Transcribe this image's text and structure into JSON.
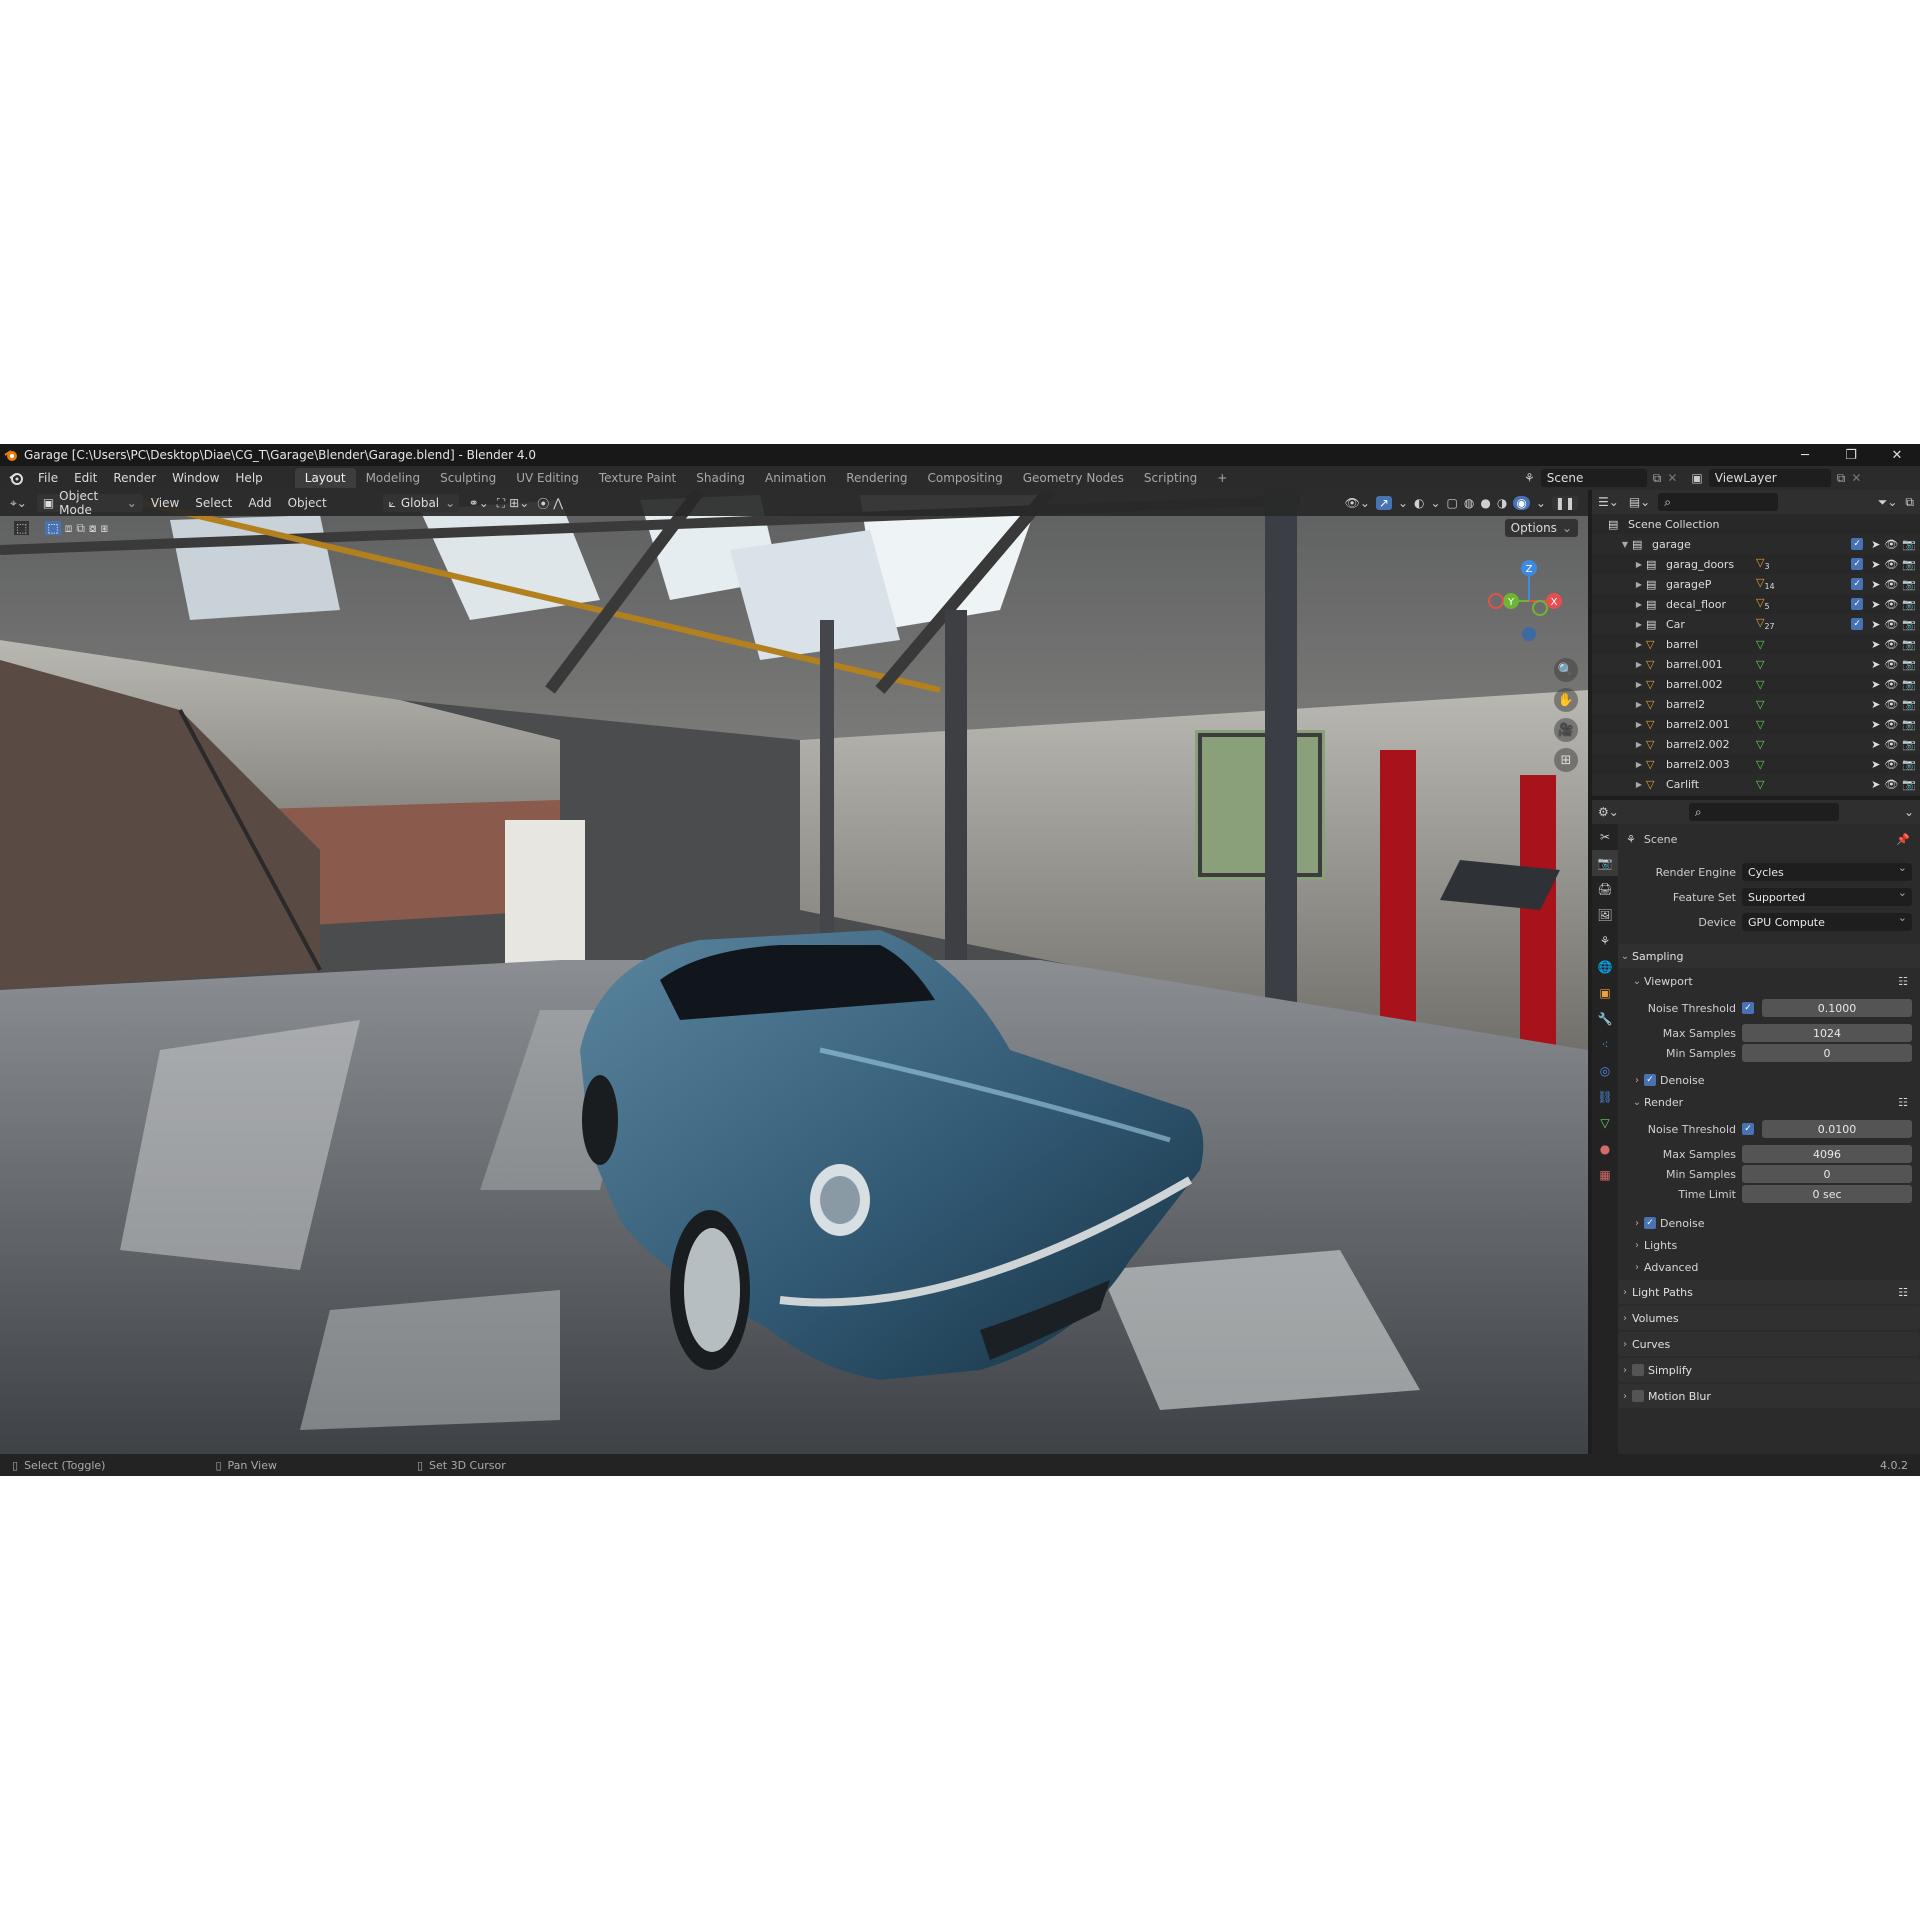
{
  "titlebar": {
    "title": "Garage [C:\\Users\\PC\\Desktop\\Diae\\CG_T\\Garage\\Blender\\Garage.blend] - Blender 4.0",
    "minimize": "─",
    "maximize": "❐",
    "close": "✕"
  },
  "menu": [
    "File",
    "Edit",
    "Render",
    "Window",
    "Help"
  ],
  "workspaces": [
    "Layout",
    "Modeling",
    "Sculpting",
    "UV Editing",
    "Texture Paint",
    "Shading",
    "Animation",
    "Rendering",
    "Compositing",
    "Geometry Nodes",
    "Scripting",
    "+"
  ],
  "scene_field": "Scene",
  "viewlayer_field": "ViewLayer",
  "viewport": {
    "mode": "Object Mode",
    "menus": [
      "View",
      "Select",
      "Add",
      "Object"
    ],
    "orientation": "Global",
    "options": "Options",
    "gizmo_axes": [
      "Z",
      "Y",
      "X"
    ]
  },
  "outliner": {
    "root": "Scene Collection",
    "collection": "garage",
    "items": [
      {
        "name": "garag_doors",
        "type": "collection",
        "count": "3"
      },
      {
        "name": "garageP",
        "type": "collection",
        "count": "14"
      },
      {
        "name": "decal_floor",
        "type": "collection",
        "count": "5"
      },
      {
        "name": "Car",
        "type": "collection",
        "count": "27"
      },
      {
        "name": "barrel",
        "type": "mesh",
        "count": ""
      },
      {
        "name": "barrel.001",
        "type": "mesh",
        "count": ""
      },
      {
        "name": "barrel.002",
        "type": "mesh",
        "count": ""
      },
      {
        "name": "barrel2",
        "type": "mesh",
        "count": ""
      },
      {
        "name": "barrel2.001",
        "type": "mesh",
        "count": ""
      },
      {
        "name": "barrel2.002",
        "type": "mesh",
        "count": ""
      },
      {
        "name": "barrel2.003",
        "type": "mesh",
        "count": ""
      },
      {
        "name": "Carlift",
        "type": "mesh",
        "count": ""
      }
    ]
  },
  "properties": {
    "context": "Scene",
    "render_engine_label": "Render Engine",
    "render_engine": "Cycles",
    "feature_set_label": "Feature Set",
    "feature_set": "Supported",
    "device_label": "Device",
    "device": "GPU Compute",
    "sampling": "Sampling",
    "viewport_label": "Viewport",
    "vp_noise_label": "Noise Threshold",
    "vp_noise": "0.1000",
    "vp_max_label": "Max Samples",
    "vp_max": "1024",
    "vp_min_label": "Min Samples",
    "vp_min": "0",
    "vp_denoise": "Denoise",
    "render_label": "Render",
    "r_noise_label": "Noise Threshold",
    "r_noise": "0.0100",
    "r_max_label": "Max Samples",
    "r_max": "4096",
    "r_min_label": "Min Samples",
    "r_min": "0",
    "r_time_label": "Time Limit",
    "r_time": "0 sec",
    "r_denoise": "Denoise",
    "lights": "Lights",
    "advanced": "Advanced",
    "light_paths": "Light Paths",
    "volumes": "Volumes",
    "curves": "Curves",
    "simplify": "Simplify",
    "motion_blur": "Motion Blur"
  },
  "statusbar": {
    "select": "Select (Toggle)",
    "pan": "Pan View",
    "cursor": "Set 3D Cursor",
    "version": "4.0.2"
  },
  "colors": {
    "accent": "#4772b3",
    "x_axis": "#e54f4f",
    "y_axis": "#6fb534",
    "z_axis": "#3d8ae0",
    "mesh": "#e8a33a",
    "data": "#6ad45b"
  }
}
